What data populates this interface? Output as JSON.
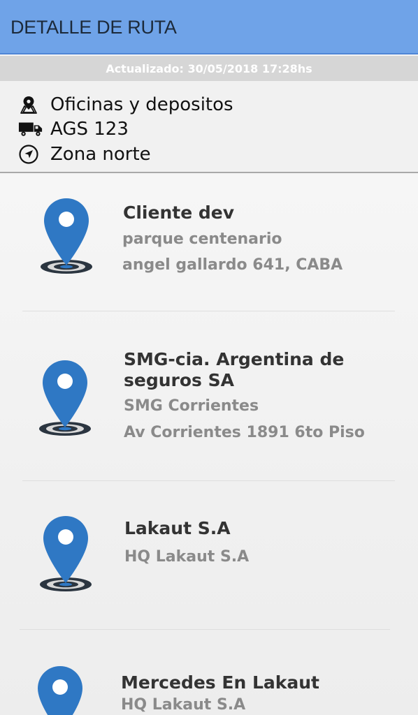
{
  "header": {
    "title": "DETALLE DE RUTA"
  },
  "updated": {
    "text": "Actualizado: 30/05/2018 17:28hs"
  },
  "route_info": {
    "location": {
      "icon": "map-pin-icon",
      "text": "Oficinas y depositos"
    },
    "vehicle": {
      "icon": "truck-icon",
      "text": "AGS 123"
    },
    "zone": {
      "icon": "navigation-arrow-icon",
      "text": "Zona norte"
    }
  },
  "stops": [
    {
      "name": "Cliente dev",
      "lines": [
        "parque centenario",
        "angel gallardo 641, CABA"
      ]
    },
    {
      "name": "SMG-cia. Argentina de seguros SA",
      "lines": [
        "SMG Corrientes",
        "Av Corrientes 1891 6to Piso"
      ]
    },
    {
      "name": "Lakaut S.A",
      "lines": [
        "HQ Lakaut S.A"
      ]
    },
    {
      "name": "Mercedes En Lakaut",
      "lines": [
        "HQ Lakaut S.A"
      ]
    }
  ],
  "colors": {
    "app_bar": "#6fa3e8",
    "pin": "#2f78c4",
    "pin_base": "#2b3540"
  }
}
